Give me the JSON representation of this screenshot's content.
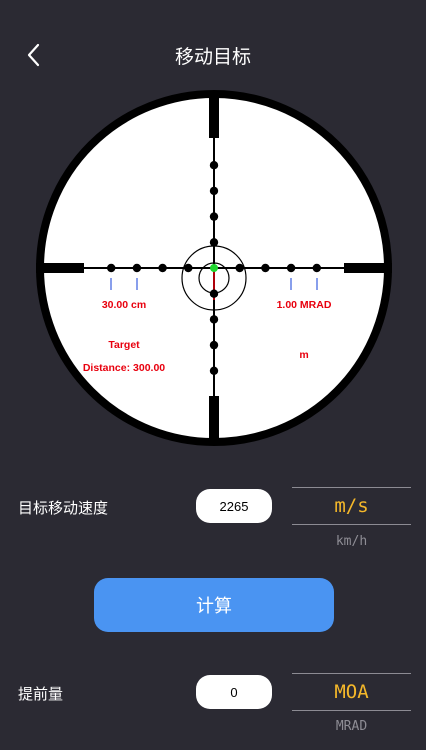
{
  "header": {
    "title": "移动目标",
    "back_icon": "chevron-left-icon"
  },
  "scope": {
    "left_label": "30.00 cm",
    "right_label": "1.00 MRAD",
    "target_line1": "Target",
    "target_line2": "Distance: 300.00",
    "unit_label": "m",
    "label_color": "#e8000e",
    "center_dot_color": "#1fd62f"
  },
  "speed": {
    "label": "目标移动速度",
    "value": "2265",
    "unit_selected": "m/s",
    "unit_alt": "km/h"
  },
  "calculate_label": "计算",
  "lead": {
    "label": "提前量",
    "value": "0",
    "unit_selected": "MOA",
    "unit_alt": "MRAD"
  },
  "colors": {
    "background": "#2b2a33",
    "accent": "#4a94f2",
    "unit_highlight": "#f5b82a"
  }
}
